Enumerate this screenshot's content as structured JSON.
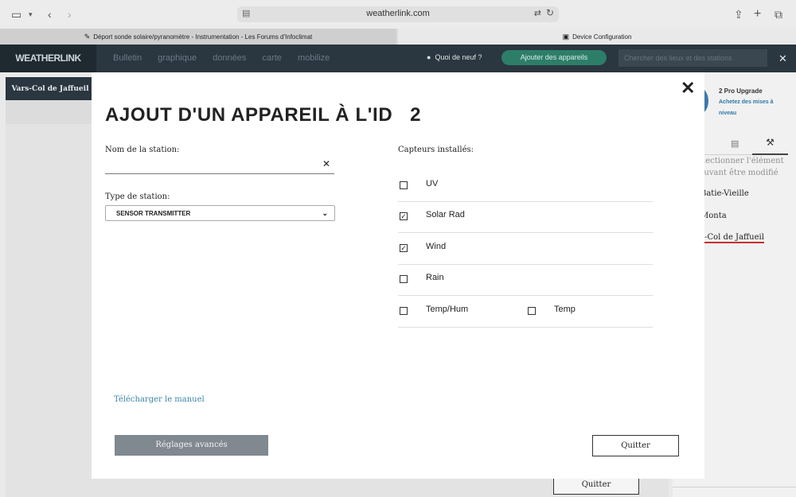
{
  "browser": {
    "url": "weatherlink.com",
    "tabs": [
      {
        "label": "Déport sonde solaire/pyranomètre - Instrumentation - Les Forums d'Infoclimat",
        "icon": "infoclimat-favicon"
      },
      {
        "label": "Device Configuration",
        "icon": "weatherlink-favicon"
      }
    ]
  },
  "site": {
    "logo": "WEATHERLINK",
    "nav": [
      "Bulletin",
      "graphique",
      "données",
      "carte",
      "mobilize"
    ],
    "whats_new": "Quoi de neuf ?",
    "add_devices": "Ajouter des appareils",
    "search_placeholder": "Chercher des lieux et des stations"
  },
  "background": {
    "station_tab": "Vars-Col de Jaffueil",
    "pro_title": "2 Pro Upgrade",
    "pro_link": "Achetez des mises à niveau",
    "notice_line1": "sélectionner l'élément",
    "notice_line2": "pouvant être modifié",
    "stations": [
      "Batie-Vieille",
      "Monta",
      "s-Col de Jaffueil"
    ],
    "quit": "Quitter"
  },
  "modal": {
    "title": "AJOUT D'UN APPAREIL À L'ID",
    "id_value": "2",
    "station_name_label": "Nom de la station:",
    "station_name_value": "",
    "station_type_label": "Type de station:",
    "station_type_value": "SENSOR TRANSMITTER",
    "sensors_label": "Capteurs installés:",
    "sensors": [
      {
        "label": "UV",
        "checked": false
      },
      {
        "label": "Solar Rad",
        "checked": true
      },
      {
        "label": "Wind",
        "checked": true
      },
      {
        "label": "Rain",
        "checked": false
      },
      {
        "label": "Temp/Hum",
        "checked": false
      },
      {
        "label": "Temp",
        "checked": false
      }
    ],
    "manual_link": "Télécharger le manuel",
    "advanced_button": "Réglages avancés",
    "quit_button": "Quitter"
  }
}
